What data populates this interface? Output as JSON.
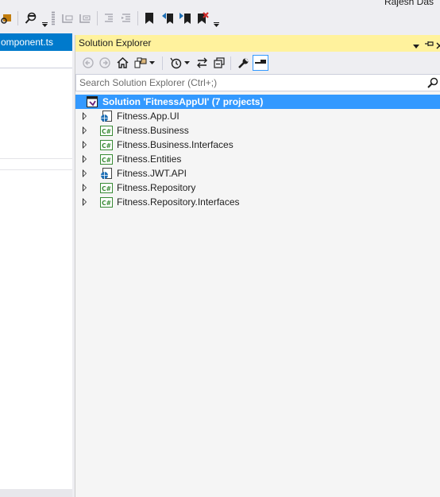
{
  "user": {
    "name": "Rajesh Das"
  },
  "editor": {
    "tab_label": "omponent.ts"
  },
  "solution_explorer": {
    "title": "Solution Explorer",
    "search_placeholder": "Search Solution Explorer (Ctrl+;)",
    "solution_label": "Solution 'FitnessAppUI' (7 projects)",
    "projects": [
      {
        "label": "Fitness.App.UI",
        "icon": "web-project-icon"
      },
      {
        "label": "Fitness.Business",
        "icon": "csharp-project-icon"
      },
      {
        "label": "Fitness.Business.Interfaces",
        "icon": "csharp-project-icon"
      },
      {
        "label": "Fitness.Entities",
        "icon": "csharp-project-icon"
      },
      {
        "label": "Fitness.JWT.API",
        "icon": "web-project-icon"
      },
      {
        "label": "Fitness.Repository",
        "icon": "csharp-project-icon"
      },
      {
        "label": "Fitness.Repository.Interfaces",
        "icon": "csharp-project-icon"
      }
    ],
    "csharp_badge": "C#"
  },
  "colors": {
    "accent_tab": "#007acc",
    "title_bar": "#fff29d",
    "selection": "#3399ff",
    "csharp_green": "#388a34"
  }
}
